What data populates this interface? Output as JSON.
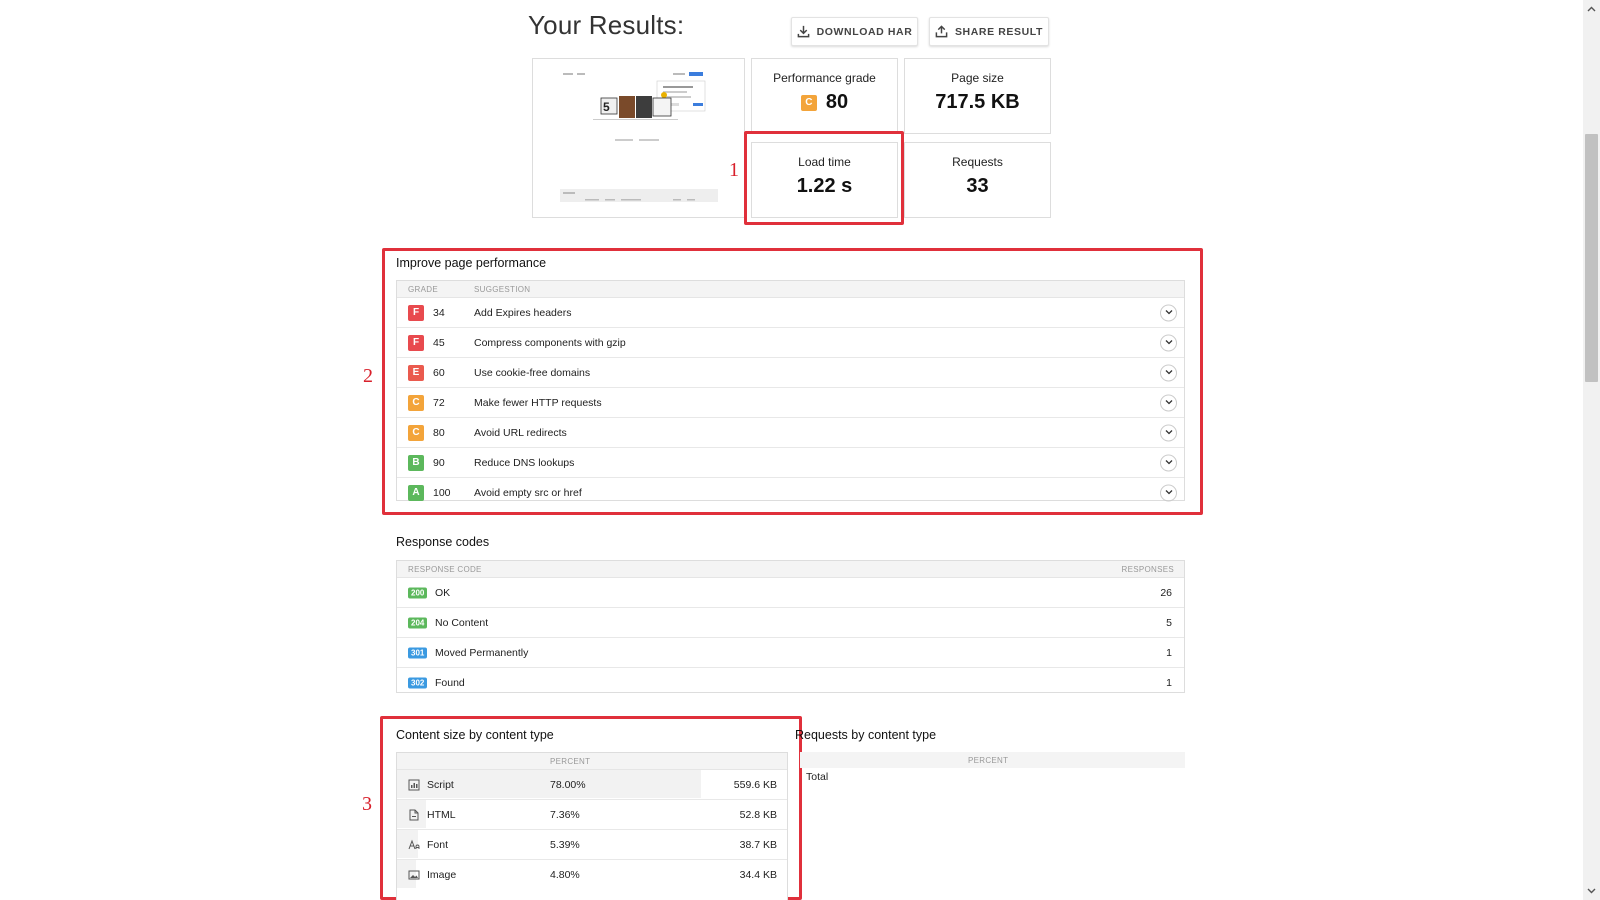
{
  "header": {
    "title": "Your Results:",
    "download_label": "DOWNLOAD HAR",
    "share_label": "SHARE RESULT"
  },
  "metrics": {
    "performance": {
      "label": "Performance grade",
      "grade": "C",
      "value": "80"
    },
    "page_size": {
      "label": "Page size",
      "value": "717.5 KB"
    },
    "load_time": {
      "label": "Load time",
      "value": "1.22 s"
    },
    "requests": {
      "label": "Requests",
      "value": "33"
    }
  },
  "annotations": [
    "1",
    "2",
    "3"
  ],
  "improve": {
    "title": "Improve page performance",
    "col_grade": "GRADE",
    "col_suggestion": "SUGGESTION",
    "rows": [
      {
        "grade": "F",
        "score": "34",
        "text": "Add Expires headers"
      },
      {
        "grade": "F",
        "score": "45",
        "text": "Compress components with gzip"
      },
      {
        "grade": "E",
        "score": "60",
        "text": "Use cookie-free domains"
      },
      {
        "grade": "C",
        "score": "72",
        "text": "Make fewer HTTP requests"
      },
      {
        "grade": "C",
        "score": "80",
        "text": "Avoid URL redirects"
      },
      {
        "grade": "B",
        "score": "90",
        "text": "Reduce DNS lookups"
      },
      {
        "grade": "A",
        "score": "100",
        "text": "Avoid empty src or href"
      }
    ]
  },
  "responses": {
    "title": "Response codes",
    "col_code": "RESPONSE CODE",
    "col_responses": "RESPONSES",
    "rows": [
      {
        "code": "200",
        "text": "OK",
        "count": "26"
      },
      {
        "code": "204",
        "text": "No Content",
        "count": "5"
      },
      {
        "code": "301",
        "text": "Moved Permanently",
        "count": "1"
      },
      {
        "code": "302",
        "text": "Found",
        "count": "1"
      }
    ]
  },
  "content_size": {
    "title": "Content size by content type",
    "col_percent": "PERCENT",
    "rows": [
      {
        "icon": "script-icon",
        "type": "Script",
        "percent": "78.00%",
        "share": 0.78,
        "size": "559.6 KB"
      },
      {
        "icon": "html-file-icon",
        "type": "HTML",
        "percent": "7.36%",
        "share": 0.0736,
        "size": "52.8 KB"
      },
      {
        "icon": "font-icon",
        "type": "Font",
        "percent": "5.39%",
        "share": 0.0539,
        "size": "38.7 KB"
      },
      {
        "icon": "image-icon",
        "type": "Image",
        "percent": "4.80%",
        "share": 0.048,
        "size": "34.4 KB"
      }
    ]
  },
  "requests_by_type": {
    "title": "Requests by content type",
    "col_percent": "PERCENT",
    "total_label": "Total"
  },
  "colors": {
    "grade_F": "#e84a4e",
    "grade_E": "#ea5a4e",
    "grade_C": "#f3a43a",
    "grade_B": "#5cb85c",
    "grade_A": "#5cb85c",
    "code_2xx": "#5cb85c",
    "code_3xx": "#3b9ae1",
    "highlight": "#e0303b"
  }
}
